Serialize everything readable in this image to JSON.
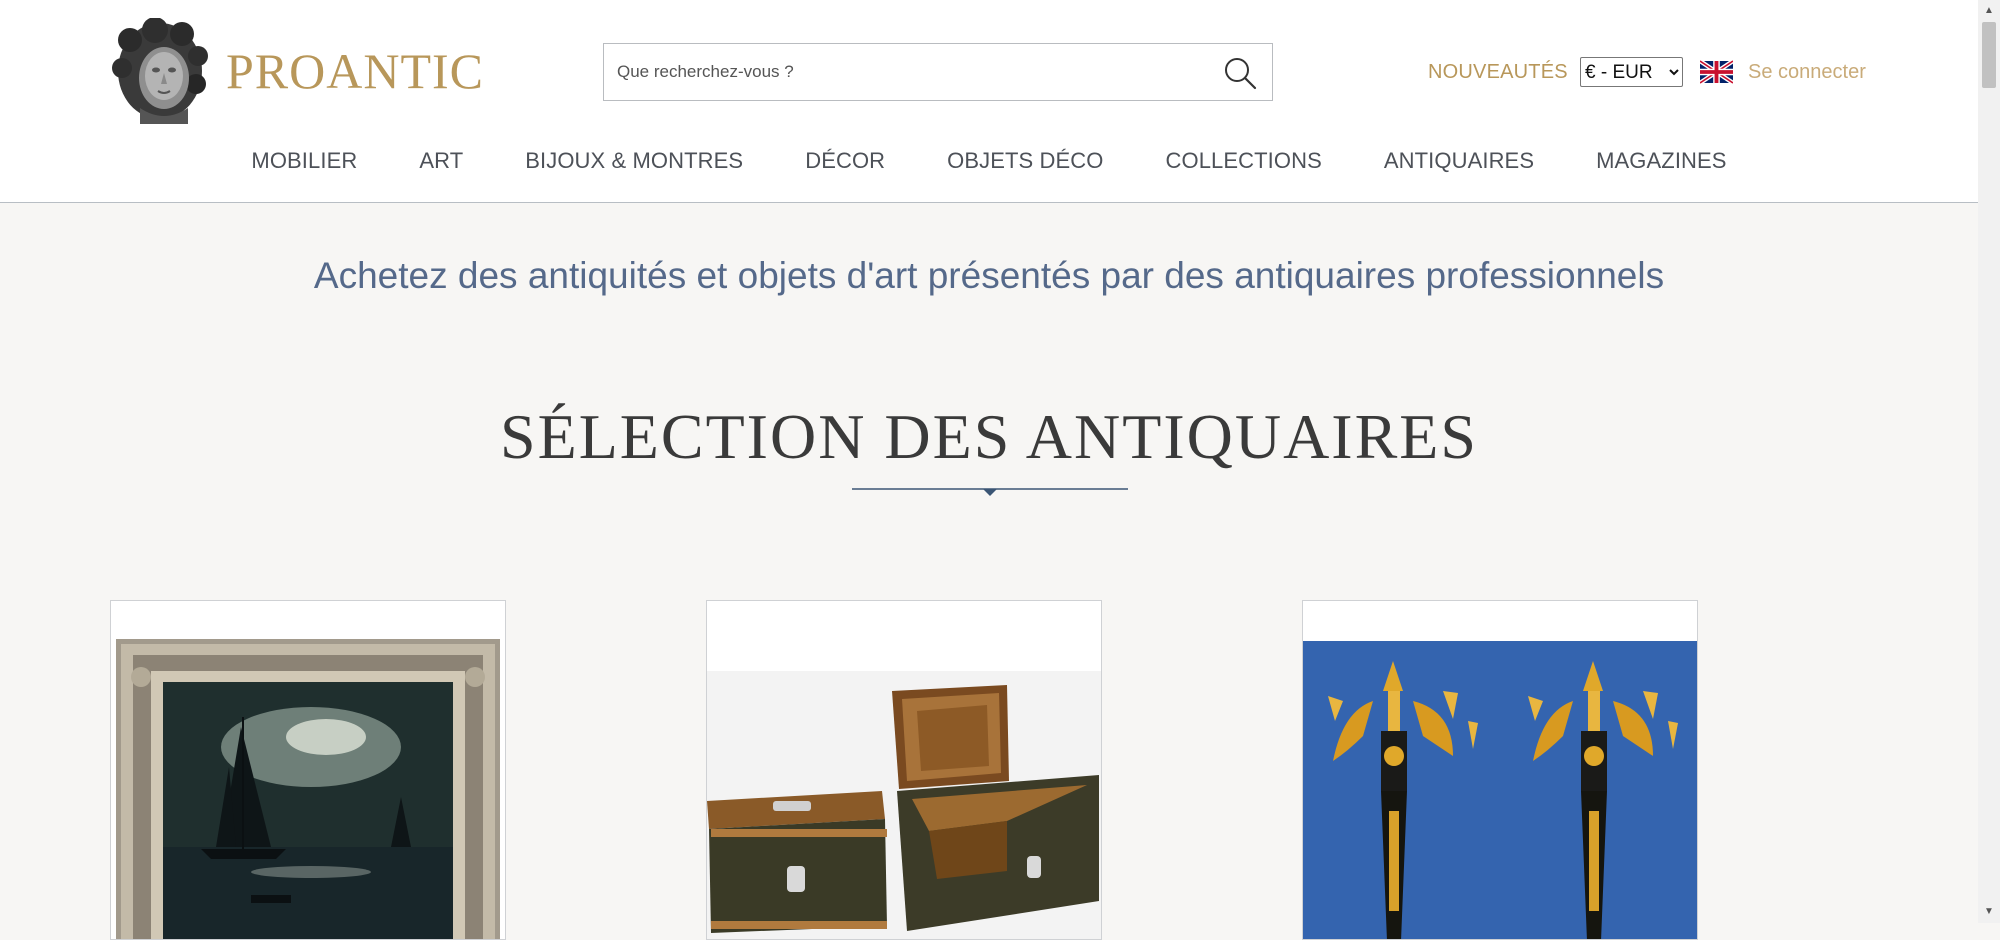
{
  "header": {
    "brand": "PROANTIC",
    "search": {
      "placeholder": "Que recherchez-vous ?",
      "value": ""
    },
    "new_link": "NOUVEAUTÉS",
    "currency": {
      "selected": "€ - EUR",
      "options": [
        "€ - EUR"
      ]
    },
    "language_icon": "uk-flag-icon",
    "login": "Se connecter"
  },
  "nav": {
    "items": [
      "MOBILIER",
      "ART",
      "BIJOUX & MONTRES",
      "DÉCOR",
      "OBJETS DÉCO",
      "COLLECTIONS",
      "ANTIQUAIRES",
      "MAGAZINES"
    ]
  },
  "hero": {
    "tagline": "Achetez des antiquités et objets d'art présentés par des antiquaires professionnels"
  },
  "selection": {
    "title": "SÉLECTION DES ANTIQUAIRES"
  },
  "colors": {
    "gold": "#b8975a",
    "tagline_blue": "#55698a",
    "rule_blue": "#3b5574",
    "background": "#f7f6f4"
  }
}
